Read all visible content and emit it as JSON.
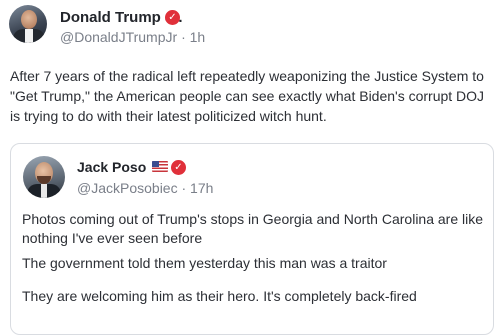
{
  "post": {
    "author_name": "Donald Trump Jr.",
    "author_handle": "@DonaldJTrumpJr",
    "separator": "·",
    "time": "1h",
    "verified_glyph": "✓",
    "body": "After 7 years of the radical left repeatedly weaponizing the Justice System to \"Get Trump,\" the American people can see exactly what Biden's corrupt DOJ is trying to do with their latest politicized witch hunt."
  },
  "quote": {
    "author_name": "Jack Poso",
    "author_handle": "@JackPosobiec",
    "separator": "·",
    "time": "17h",
    "verified_glyph": "✓",
    "flag_icon": "us-flag-icon",
    "paragraphs": [
      "Photos coming out of Trump's stops in Georgia and North Carolina are like nothing I've ever seen before",
      "The government told them yesterday this man was a traitor",
      "They are welcoming him as their hero. It's completely back-fired"
    ]
  },
  "colors": {
    "verified_badge": "#e0303a",
    "handle_text": "#7a7f89",
    "border": "#d9dce1"
  }
}
